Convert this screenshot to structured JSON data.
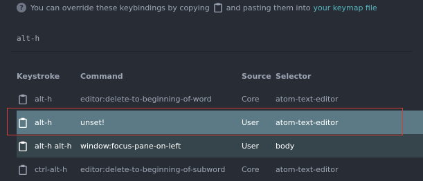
{
  "info": {
    "icon": "question-circle-icon",
    "before_text": "You can override these keybindings by copying",
    "after_text": "and pasting them into",
    "link_text": "your keymap file"
  },
  "filter": {
    "value": "alt-h"
  },
  "table": {
    "headers": {
      "keystroke": "Keystroke",
      "command": "Command",
      "source": "Source",
      "selector": "Selector"
    },
    "rows": [
      {
        "keystroke": "alt-h",
        "command": "editor:delete-to-beginning-of-word",
        "source": "Core",
        "selector": "atom-text-editor"
      },
      {
        "keystroke": "alt-h",
        "command": "unset!",
        "source": "User",
        "selector": "atom-text-editor"
      },
      {
        "keystroke": "alt-h alt-h",
        "command": "window:focus-pane-on-left",
        "source": "User",
        "selector": "body"
      },
      {
        "keystroke": "ctrl-alt-h",
        "command": "editor:delete-to-beginning-of-subword",
        "source": "Core",
        "selector": "atom-text-editor"
      }
    ]
  },
  "colors": {
    "background": "#282c34",
    "selected_row": "#5b7a86",
    "highlight_row": "#36454c",
    "link": "#56b6c2",
    "annotation_box": "#d93b3b"
  }
}
